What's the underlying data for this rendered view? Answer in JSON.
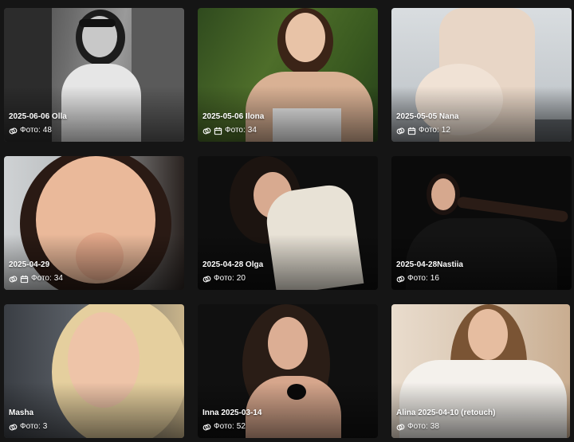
{
  "gallery": {
    "photo_label": "Фото:",
    "albums": [
      {
        "title": "2025-06-06 Olla",
        "count": "48",
        "calendar": false
      },
      {
        "title": "2025-05-06 Ilona",
        "count": "34",
        "calendar": true
      },
      {
        "title": "2025-05-05 Nana",
        "count": "12",
        "calendar": true
      },
      {
        "title": "2025-04-29",
        "count": "34",
        "calendar": true
      },
      {
        "title": "2025-04-28 Olga",
        "count": "20",
        "calendar": false
      },
      {
        "title": "2025-04-28Nastiia",
        "count": "16",
        "calendar": false
      },
      {
        "title": "Masha",
        "count": "3",
        "calendar": false
      },
      {
        "title": "Inna 2025-03-14",
        "count": "52",
        "calendar": false
      },
      {
        "title": "Alina 2025-04-10 (retouch)",
        "count": "38",
        "calendar": false
      }
    ]
  },
  "colors": {
    "page_background": "#151515",
    "caption_text": "#ffffff"
  },
  "icons": {
    "album_icon": "linked-photos-icon",
    "date_icon": "calendar-icon"
  }
}
